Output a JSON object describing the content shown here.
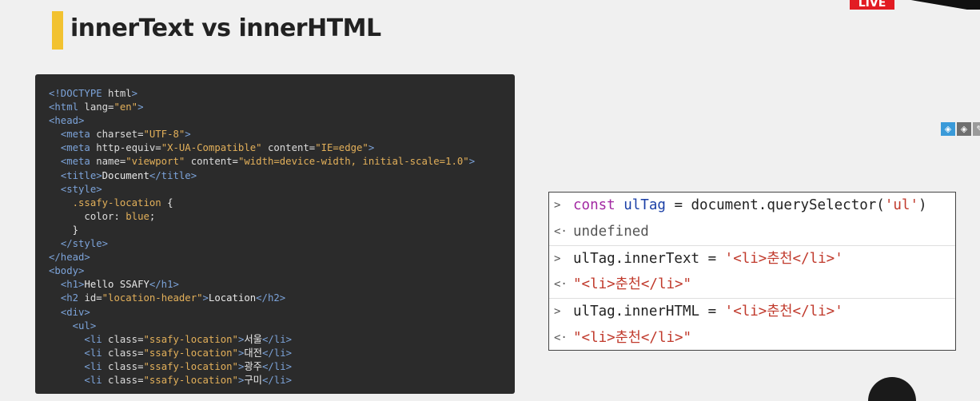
{
  "slide": {
    "title": "innerText vs innerHTML",
    "live_badge": "LIVE"
  },
  "code_lines": [
    [
      {
        "c": "t-tag",
        "t": "<!DOCTYPE "
      },
      {
        "c": "t-attr",
        "t": "html"
      },
      {
        "c": "t-tag",
        "t": ">"
      }
    ],
    [
      {
        "c": "t-tag",
        "t": "<html "
      },
      {
        "c": "t-attr",
        "t": "lang"
      },
      {
        "c": "t-txt",
        "t": "="
      },
      {
        "c": "t-str",
        "t": "\"en\""
      },
      {
        "c": "t-tag",
        "t": ">"
      }
    ],
    [
      {
        "c": "t-tag",
        "t": "<head>"
      }
    ],
    [
      {
        "c": "t-txt",
        "t": "  "
      },
      {
        "c": "t-tag",
        "t": "<meta "
      },
      {
        "c": "t-attr",
        "t": "charset"
      },
      {
        "c": "t-txt",
        "t": "="
      },
      {
        "c": "t-str",
        "t": "\"UTF-8\""
      },
      {
        "c": "t-tag",
        "t": ">"
      }
    ],
    [
      {
        "c": "t-txt",
        "t": "  "
      },
      {
        "c": "t-tag",
        "t": "<meta "
      },
      {
        "c": "t-attr",
        "t": "http-equiv"
      },
      {
        "c": "t-txt",
        "t": "="
      },
      {
        "c": "t-str",
        "t": "\"X-UA-Compatible\""
      },
      {
        "c": "t-txt",
        "t": " "
      },
      {
        "c": "t-attr",
        "t": "content"
      },
      {
        "c": "t-txt",
        "t": "="
      },
      {
        "c": "t-str",
        "t": "\"IE=edge\""
      },
      {
        "c": "t-tag",
        "t": ">"
      }
    ],
    [
      {
        "c": "t-txt",
        "t": "  "
      },
      {
        "c": "t-tag",
        "t": "<meta "
      },
      {
        "c": "t-attr",
        "t": "name"
      },
      {
        "c": "t-txt",
        "t": "="
      },
      {
        "c": "t-str",
        "t": "\"viewport\""
      },
      {
        "c": "t-txt",
        "t": " "
      },
      {
        "c": "t-attr",
        "t": "content"
      },
      {
        "c": "t-txt",
        "t": "="
      },
      {
        "c": "t-str",
        "t": "\"width=device-width, initial-scale=1.0\""
      },
      {
        "c": "t-tag",
        "t": ">"
      }
    ],
    [
      {
        "c": "t-txt",
        "t": "  "
      },
      {
        "c": "t-tag",
        "t": "<title>"
      },
      {
        "c": "t-txt",
        "t": "Document"
      },
      {
        "c": "t-tag",
        "t": "</title>"
      }
    ],
    [
      {
        "c": "t-txt",
        "t": "  "
      },
      {
        "c": "t-tag",
        "t": "<style>"
      }
    ],
    [
      {
        "c": "t-txt",
        "t": "    "
      },
      {
        "c": "t-sel",
        "t": ".ssafy-location"
      },
      {
        "c": "t-txt",
        "t": " {"
      }
    ],
    [
      {
        "c": "t-txt",
        "t": "      "
      },
      {
        "c": "t-attr",
        "t": "color"
      },
      {
        "c": "t-txt",
        "t": ": "
      },
      {
        "c": "t-sel",
        "t": "blue"
      },
      {
        "c": "t-txt",
        "t": ";"
      }
    ],
    [
      {
        "c": "t-txt",
        "t": "    }"
      }
    ],
    [
      {
        "c": "t-txt",
        "t": "  "
      },
      {
        "c": "t-tag",
        "t": "</style>"
      }
    ],
    [
      {
        "c": "t-tag",
        "t": "</head>"
      }
    ],
    [
      {
        "c": "t-tag",
        "t": "<body>"
      }
    ],
    [
      {
        "c": "t-txt",
        "t": "  "
      },
      {
        "c": "t-tag",
        "t": "<h1>"
      },
      {
        "c": "t-txt",
        "t": "Hello SSAFY"
      },
      {
        "c": "t-tag",
        "t": "</h1>"
      }
    ],
    [
      {
        "c": "t-txt",
        "t": "  "
      },
      {
        "c": "t-tag",
        "t": "<h2 "
      },
      {
        "c": "t-attr",
        "t": "id"
      },
      {
        "c": "t-txt",
        "t": "="
      },
      {
        "c": "t-str",
        "t": "\"location-header\""
      },
      {
        "c": "t-tag",
        "t": ">"
      },
      {
        "c": "t-txt",
        "t": "Location"
      },
      {
        "c": "t-tag",
        "t": "</h2>"
      }
    ],
    [
      {
        "c": "t-txt",
        "t": "  "
      },
      {
        "c": "t-tag",
        "t": "<div>"
      }
    ],
    [
      {
        "c": "t-txt",
        "t": "    "
      },
      {
        "c": "t-tag",
        "t": "<ul>"
      }
    ],
    [
      {
        "c": "t-txt",
        "t": "      "
      },
      {
        "c": "t-tag",
        "t": "<li "
      },
      {
        "c": "t-attr",
        "t": "class"
      },
      {
        "c": "t-txt",
        "t": "="
      },
      {
        "c": "t-str",
        "t": "\"ssafy-location\""
      },
      {
        "c": "t-tag",
        "t": ">"
      },
      {
        "c": "t-txt",
        "t": "서울"
      },
      {
        "c": "t-tag",
        "t": "</li>"
      }
    ],
    [
      {
        "c": "t-txt",
        "t": "      "
      },
      {
        "c": "t-tag",
        "t": "<li "
      },
      {
        "c": "t-attr",
        "t": "class"
      },
      {
        "c": "t-txt",
        "t": "="
      },
      {
        "c": "t-str",
        "t": "\"ssafy-location\""
      },
      {
        "c": "t-tag",
        "t": ">"
      },
      {
        "c": "t-txt",
        "t": "대전"
      },
      {
        "c": "t-tag",
        "t": "</li>"
      }
    ],
    [
      {
        "c": "t-txt",
        "t": "      "
      },
      {
        "c": "t-tag",
        "t": "<li "
      },
      {
        "c": "t-attr",
        "t": "class"
      },
      {
        "c": "t-txt",
        "t": "="
      },
      {
        "c": "t-str",
        "t": "\"ssafy-location\""
      },
      {
        "c": "t-tag",
        "t": ">"
      },
      {
        "c": "t-txt",
        "t": "광주"
      },
      {
        "c": "t-tag",
        "t": "</li>"
      }
    ],
    [
      {
        "c": "t-txt",
        "t": "      "
      },
      {
        "c": "t-tag",
        "t": "<li "
      },
      {
        "c": "t-attr",
        "t": "class"
      },
      {
        "c": "t-txt",
        "t": "="
      },
      {
        "c": "t-str",
        "t": "\"ssafy-location\""
      },
      {
        "c": "t-tag",
        "t": ">"
      },
      {
        "c": "t-txt",
        "t": "구미"
      },
      {
        "c": "t-tag",
        "t": "</li>"
      }
    ]
  ],
  "console": {
    "prompt_in": ">",
    "prompt_out": "<·",
    "rows": [
      {
        "type": "input",
        "parts": [
          {
            "c": "kw",
            "t": "const "
          },
          {
            "c": "var",
            "t": "ulTag"
          },
          {
            "c": "plain",
            "t": " = document.querySelector("
          },
          {
            "c": "strc",
            "t": "'ul'"
          },
          {
            "c": "plain",
            "t": ")"
          }
        ]
      },
      {
        "type": "output",
        "parts": [
          {
            "c": "gray",
            "t": "undefined"
          }
        ]
      },
      {
        "type": "input",
        "parts": [
          {
            "c": "plain",
            "t": "ulTag.innerText = "
          },
          {
            "c": "strc",
            "t": "'<li>춘천</li>'"
          }
        ]
      },
      {
        "type": "output",
        "parts": [
          {
            "c": "strc",
            "t": "\"<li>춘천</li>\""
          }
        ]
      },
      {
        "type": "input",
        "parts": [
          {
            "c": "plain",
            "t": "ulTag.innerHTML = "
          },
          {
            "c": "strc",
            "t": "'<li>춘천</li>'"
          }
        ]
      },
      {
        "type": "output",
        "parts": [
          {
            "c": "strc",
            "t": "\"<li>춘천</li>\""
          }
        ]
      }
    ]
  },
  "side_toolbar": {
    "icons": [
      "tag-icon",
      "tag-icon",
      "edit-icon"
    ],
    "colors": [
      "#3a9ad9",
      "#6f6f6f",
      "#9a9a9a"
    ]
  }
}
